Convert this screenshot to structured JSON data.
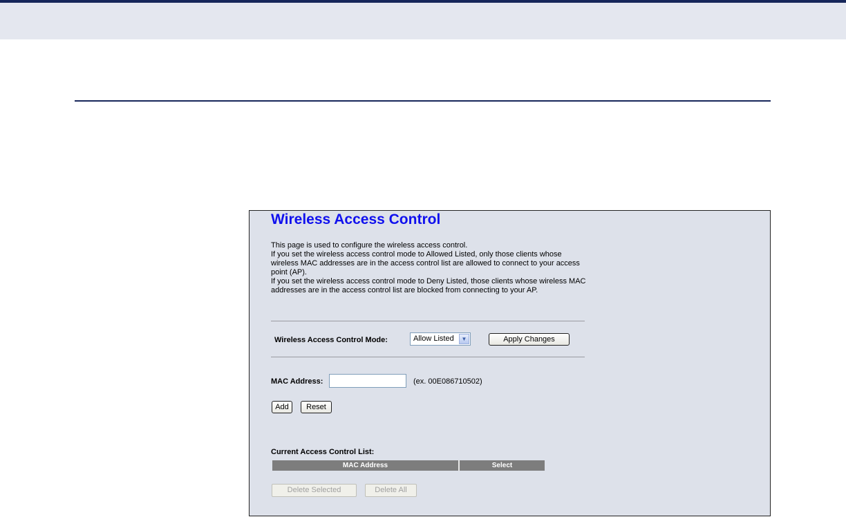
{
  "page": {
    "title": "Wireless Access Control",
    "description": [
      "This page is used to configure the wireless access control.",
      "If you set the wireless access control mode to Allowed Listed, only those clients whose wireless MAC addresses are in the access control list are allowed to connect to your access point (AP).",
      "If you set the wireless access control mode to Deny Listed, those clients whose wireless MAC addresses are in the access control list are blocked from connecting to your AP."
    ]
  },
  "mode": {
    "label": "Wireless Access Control Mode:",
    "selected": "Allow Listed",
    "apply_label": "Apply Changes"
  },
  "mac": {
    "label": "MAC Address:",
    "value": "",
    "example": "(ex. 00E086710502)",
    "add_label": "Add",
    "reset_label": "Reset"
  },
  "list": {
    "label": "Current Access Control List:",
    "columns": [
      "MAC Address",
      "Select"
    ],
    "delete_selected_label": "Delete Selected",
    "delete_all_label": "Delete All"
  }
}
